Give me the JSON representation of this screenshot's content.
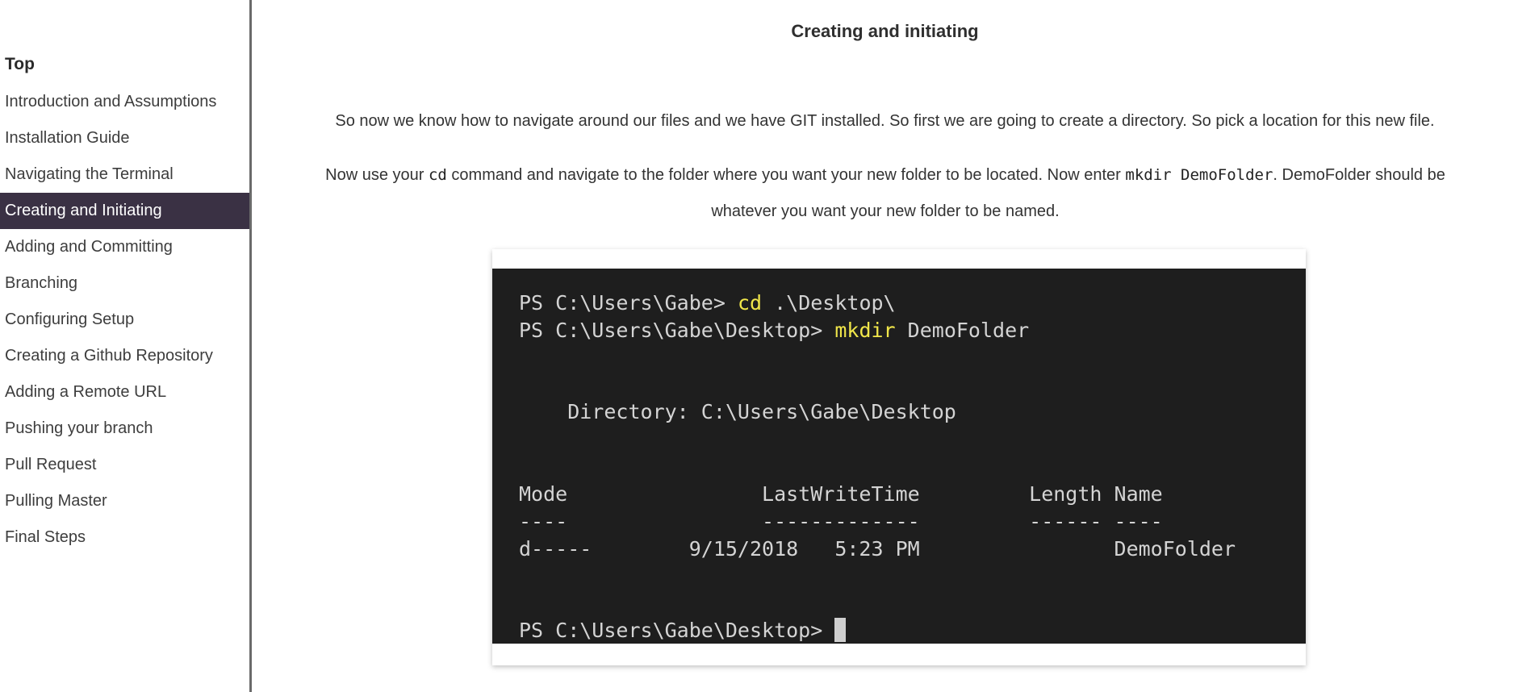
{
  "sidebar": {
    "items": [
      {
        "label": "Top"
      },
      {
        "label": "Introduction and Assumptions"
      },
      {
        "label": "Installation Guide"
      },
      {
        "label": "Navigating the Terminal"
      },
      {
        "label": "Creating and Initiating"
      },
      {
        "label": "Adding and Committing"
      },
      {
        "label": "Branching"
      },
      {
        "label": "Configuring Setup"
      },
      {
        "label": "Creating a Github Repository"
      },
      {
        "label": "Adding a Remote URL"
      },
      {
        "label": "Pushing your branch"
      },
      {
        "label": "Pull Request"
      },
      {
        "label": "Pulling Master"
      },
      {
        "label": "Final Steps"
      }
    ],
    "active_color": "#3a3144"
  },
  "main": {
    "heading": "Creating and initiating",
    "para1": "So now we know how to navigate around our files and we have GIT installed. So first we are going to create a directory. So pick a location for this new file.",
    "para2": {
      "part1": "Now use your ",
      "code1": "cd",
      "part2": " command and navigate to the folder where you want your new folder to be located. Now enter ",
      "code2": "mkdir DemoFolder",
      "part3": ". DemoFolder should be whatever you want your new folder to be named."
    }
  },
  "terminal": {
    "line1_prompt": "PS C:\\Users\\Gabe> ",
    "line1_cmd": "cd",
    "line1_arg": " .\\Desktop\\",
    "line2_prompt": "PS C:\\Users\\Gabe\\Desktop> ",
    "line2_cmd": "mkdir",
    "line2_arg": " DemoFolder",
    "dir_line": "    Directory: C:\\Users\\Gabe\\Desktop",
    "header_line": "Mode                LastWriteTime         Length Name",
    "sep_line": "----                -------------         ------ ----",
    "row_line": "d-----        9/15/2018   5:23 PM                DemoFolder",
    "final_prompt": "PS C:\\Users\\Gabe\\Desktop> ",
    "bg_color": "#1e1e1e",
    "cmd_color": "#f0e64a"
  }
}
